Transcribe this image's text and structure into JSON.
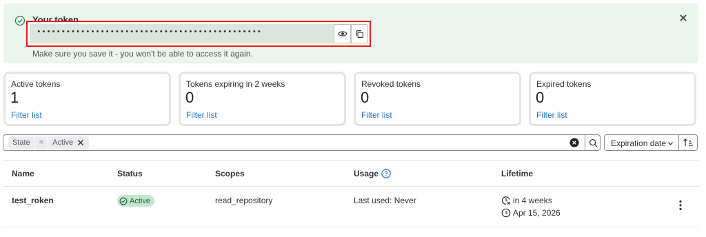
{
  "alert": {
    "title": "Your token",
    "token_value": "••••••••••••••••••••••••••••••••••••••••••••••",
    "help_text": "Make sure you save it - you won't be able to access it again.",
    "icons": {
      "status": "check-circle-icon",
      "reveal": "eye-icon",
      "copy": "copy-icon",
      "close": "close-icon"
    }
  },
  "stats": [
    {
      "label": "Active tokens",
      "value": "1",
      "link": "Filter list"
    },
    {
      "label": "Tokens expiring in 2 weeks",
      "value": "0",
      "link": "Filter list"
    },
    {
      "label": "Revoked tokens",
      "value": "0",
      "link": "Filter list"
    },
    {
      "label": "Expired tokens",
      "value": "0",
      "link": "Filter list"
    }
  ],
  "filter": {
    "token_key": "State",
    "token_op": "=",
    "token_value": "Active"
  },
  "sort": {
    "label": "Expiration date"
  },
  "table": {
    "headers": {
      "name": "Name",
      "status": "Status",
      "scopes": "Scopes",
      "usage": "Usage",
      "lifetime": "Lifetime"
    },
    "rows": [
      {
        "name": "test_roken",
        "status": "Active",
        "scopes": "read_repository",
        "usage": "Last used: Never",
        "expires_in": "in 4 weeks",
        "expires_on": "Apr 15, 2026"
      }
    ]
  },
  "colors": {
    "alert_bg": "#ecf4ee",
    "highlight": "#e31b1b",
    "link": "#1f75cb",
    "badge_bg": "#c3e6cd",
    "badge_fg": "#24663b"
  }
}
